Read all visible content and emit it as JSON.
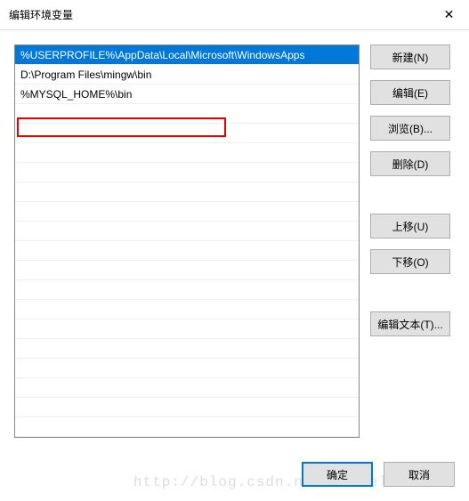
{
  "titlebar": {
    "title": "编辑环境变量",
    "close_icon": "✕"
  },
  "list": {
    "items": [
      "%USERPROFILE%\\AppData\\Local\\Microsoft\\WindowsApps",
      "D:\\Program Files\\mingw\\bin",
      "%MYSQL_HOME%\\bin"
    ],
    "selected_index": 0,
    "highlighted_index": 2
  },
  "buttons": {
    "new": "新建(N)",
    "edit": "编辑(E)",
    "browse": "浏览(B)...",
    "delete": "删除(D)",
    "move_up": "上移(U)",
    "move_down": "下移(O)",
    "edit_text": "编辑文本(T)..."
  },
  "footer": {
    "ok": "确定",
    "cancel": "取消"
  },
  "watermark": "http://blog.csdn.net/MarvelWLM"
}
